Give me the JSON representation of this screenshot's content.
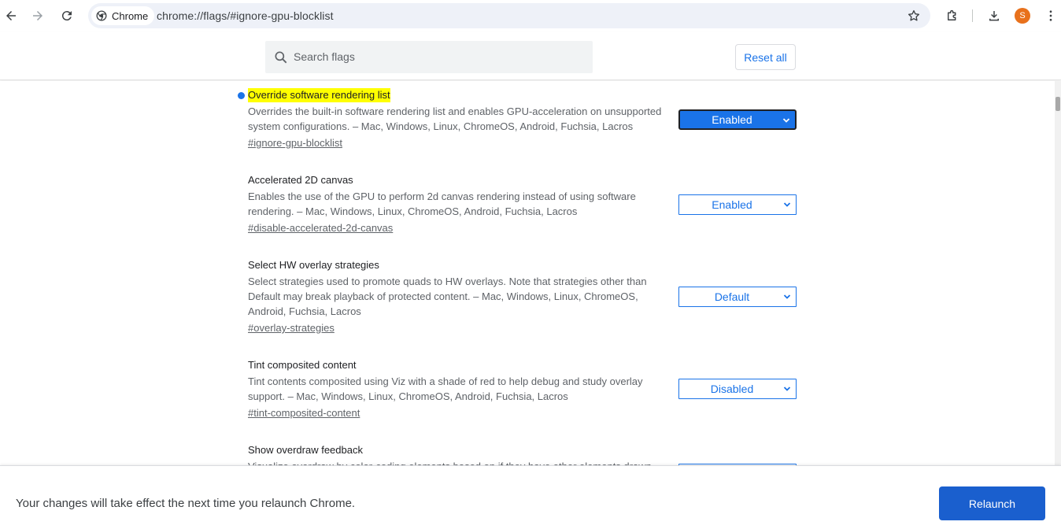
{
  "browser": {
    "chip_label": "Chrome",
    "url": "chrome://flags/#ignore-gpu-blocklist",
    "avatar_letter": "S",
    "accent": "#1a73e8",
    "avatar_color": "#e8711c"
  },
  "header": {
    "search_placeholder": "Search flags",
    "reset_label": "Reset all"
  },
  "flags": [
    {
      "title": "Override software rendering list",
      "highlighted": true,
      "modified": true,
      "description": "Overrides the built-in software rendering list and enables GPU-acceleration on unsupported system configurations. – Mac, Windows, Linux, ChromeOS, Android, Fuchsia, Lacros",
      "link": "#ignore-gpu-blocklist",
      "value": "Enabled"
    },
    {
      "title": "Accelerated 2D canvas",
      "description": "Enables the use of the GPU to perform 2d canvas rendering instead of using software rendering. – Mac, Windows, Linux, ChromeOS, Android, Fuchsia, Lacros",
      "link": "#disable-accelerated-2d-canvas",
      "value": "Enabled"
    },
    {
      "title": "Select HW overlay strategies",
      "description": "Select strategies used to promote quads to HW overlays. Note that strategies other than Default may break playback of protected content. – Mac, Windows, Linux, ChromeOS, Android, Fuchsia, Lacros",
      "link": "#overlay-strategies",
      "value": "Default"
    },
    {
      "title": "Tint composited content",
      "description": "Tint contents composited using Viz with a shade of red to help debug and study overlay support. – Mac, Windows, Linux, ChromeOS, Android, Fuchsia, Lacros",
      "link": "#tint-composited-content",
      "value": "Disabled"
    },
    {
      "title": "Show overdraw feedback",
      "description": "Visualize overdraw by color-coding elements based on if they have other elements drawn underneath.",
      "link": "",
      "value": ""
    }
  ],
  "bottom": {
    "message": "Your changes will take effect the next time you relaunch Chrome.",
    "relaunch_label": "Relaunch"
  }
}
